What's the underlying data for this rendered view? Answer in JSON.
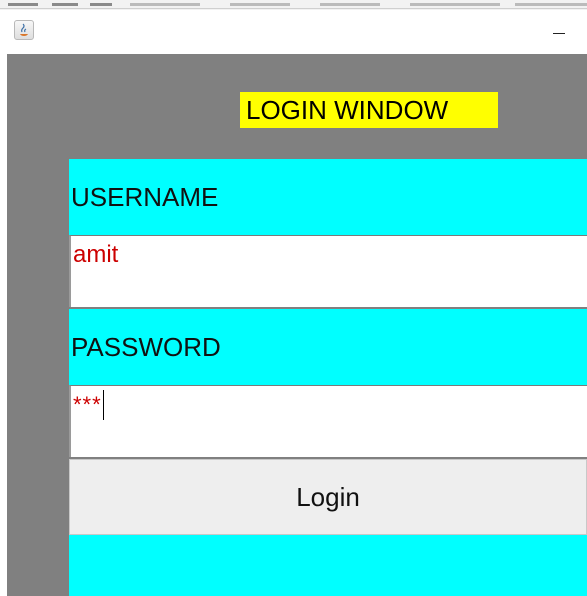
{
  "window": {
    "minimize_glyph": "–",
    "icon": "java-app-icon"
  },
  "form": {
    "heading": "LOGIN WINDOW",
    "username_label": "USERNAME",
    "username_value": "amit",
    "password_label": "PASSWORD",
    "password_masked": "***",
    "login_label": "Login"
  },
  "colors": {
    "background": "#808080",
    "panel": "#00ffff",
    "heading_bg": "#ffff00",
    "field_text": "#cc0000",
    "button_bg": "#eeeeee"
  }
}
